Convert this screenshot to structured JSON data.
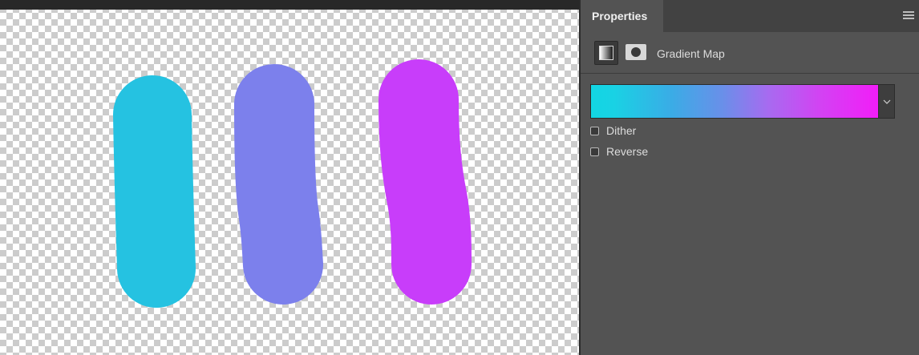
{
  "panel": {
    "tab_label": "Properties",
    "menu_icon": "panel-menu-icon",
    "adjustment_icon": "gradient-map-icon",
    "mask_icon": "layer-mask-icon",
    "adjustment_title": "Gradient Map"
  },
  "gradient": {
    "colors": [
      "#12d6e3",
      "#6a8fe9",
      "#f21df8"
    ],
    "dropdown_icon": "chevron-down-icon"
  },
  "options": {
    "dither_label": "Dither",
    "dither_checked": false,
    "reverse_label": "Reverse",
    "reverse_checked": false
  },
  "canvas": {
    "stroke_colors": [
      "#25c2e1",
      "#7c80ec",
      "#c83dfa"
    ]
  }
}
